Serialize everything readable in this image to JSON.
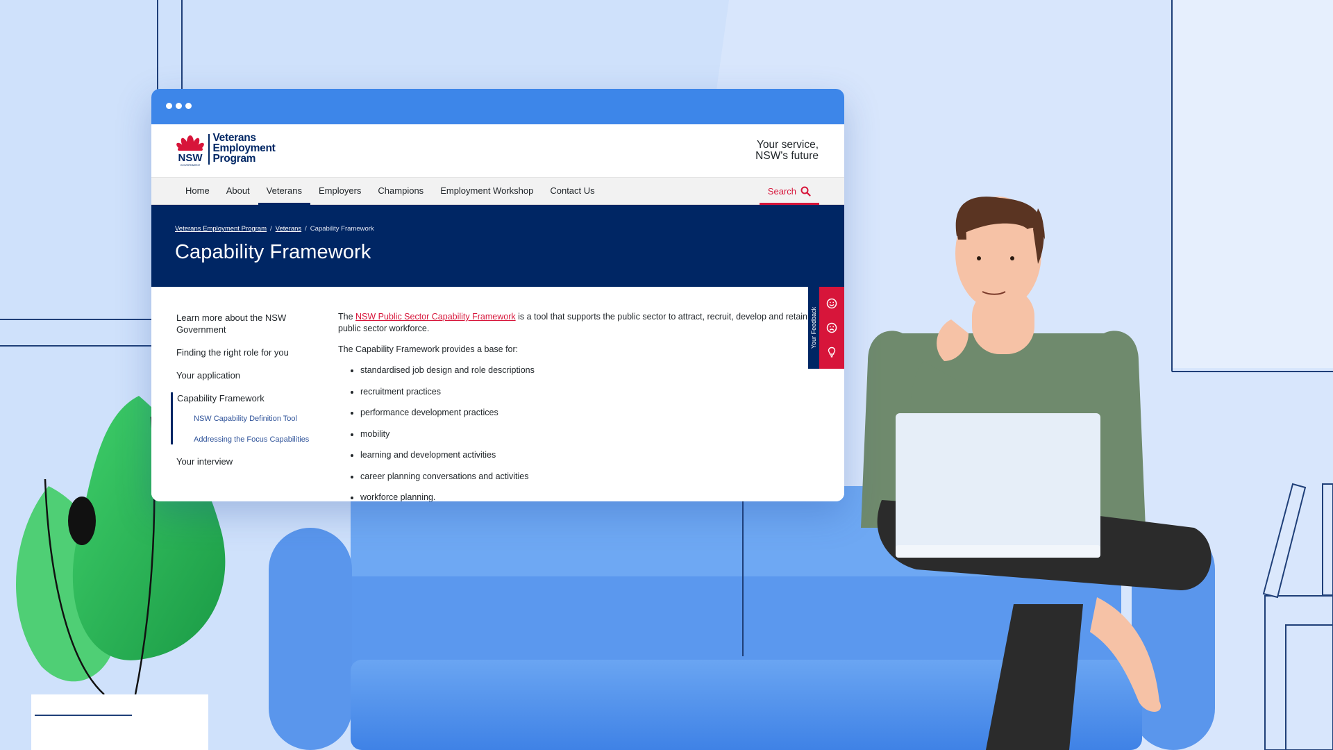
{
  "colors": {
    "nsw_blue": "#002664",
    "nsw_red": "#d7153a",
    "titlebar_blue": "#3d86e9"
  },
  "logo": {
    "lines": [
      "Veterans",
      "Employment",
      "Program"
    ],
    "mark_text": "NSW",
    "mark_subtext": "GOVERNMENT"
  },
  "header": {
    "tagline_line1": "Your service,",
    "tagline_line2": "NSW's future"
  },
  "nav": {
    "items": [
      {
        "label": "Home"
      },
      {
        "label": "About"
      },
      {
        "label": "Veterans"
      },
      {
        "label": "Employers"
      },
      {
        "label": "Champions"
      },
      {
        "label": "Employment Workshop"
      },
      {
        "label": "Contact Us"
      }
    ],
    "active": "Veterans",
    "search_label": "Search",
    "search_icon": "search-icon"
  },
  "breadcrumb": {
    "items": [
      "Veterans Employment Program",
      "Veterans",
      "Capability Framework"
    ],
    "separator": "/"
  },
  "page": {
    "title": "Capability Framework"
  },
  "sidenav": {
    "items": [
      {
        "label": "Learn more about the NSW Government"
      },
      {
        "label": "Finding the right role for you"
      },
      {
        "label": "Your application"
      },
      {
        "label": "Capability Framework"
      },
      {
        "label": "Your interview"
      }
    ],
    "subitems": [
      {
        "label": "NSW Capability Definition Tool"
      },
      {
        "label": "Addressing the Focus Capabilities"
      }
    ]
  },
  "content": {
    "intro_prefix": "The ",
    "intro_link": "NSW Public Sector Capability Framework",
    "intro_suffix": " is a tool that supports the public sector to attract, recruit, develop and retain the public sector workforce.",
    "base_for": "The Capability Framework provides a base for:",
    "bullets": [
      "standardised job design and role descriptions",
      "recruitment practices",
      "performance development practices",
      "mobility",
      "learning and development activities",
      "career planning conversations and activities",
      "workforce planning."
    ]
  },
  "feedback": {
    "tab_label": "Your Feedback",
    "icons": [
      "smile-icon",
      "frown-icon",
      "lightbulb-icon"
    ]
  }
}
